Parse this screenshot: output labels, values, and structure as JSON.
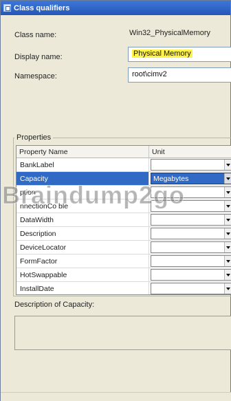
{
  "window": {
    "title": "Class qualifiers"
  },
  "class_name": {
    "label": "Class name:",
    "value": "Win32_PhysicalMemory"
  },
  "display_name": {
    "label": "Display name:",
    "value": "Physical Memory"
  },
  "namespace": {
    "label": "Namespace:",
    "value": "root\\cimv2"
  },
  "properties": {
    "group_label": "Properties",
    "columns": {
      "name": "Property Name",
      "unit": "Unit"
    },
    "rows": [
      {
        "name": "BankLabel",
        "unit": ""
      },
      {
        "name": "Capacity",
        "unit": "Megabytes",
        "selected": true
      },
      {
        "name": "ption",
        "unit": ""
      },
      {
        "name": "nnectionCo   ble",
        "unit": ""
      },
      {
        "name": "DataWidth",
        "unit": ""
      },
      {
        "name": "Description",
        "unit": ""
      },
      {
        "name": "DeviceLocator",
        "unit": ""
      },
      {
        "name": "FormFactor",
        "unit": ""
      },
      {
        "name": "HotSwappable",
        "unit": ""
      },
      {
        "name": "InstallDate",
        "unit": ""
      }
    ]
  },
  "description": {
    "label": "Description of Capacity:",
    "value": ""
  },
  "watermark": {
    "text": "Braindump2go"
  },
  "colors": {
    "selection": "#316ac5",
    "highlight": "#fff34a",
    "title_bar": "#2f64c8"
  }
}
